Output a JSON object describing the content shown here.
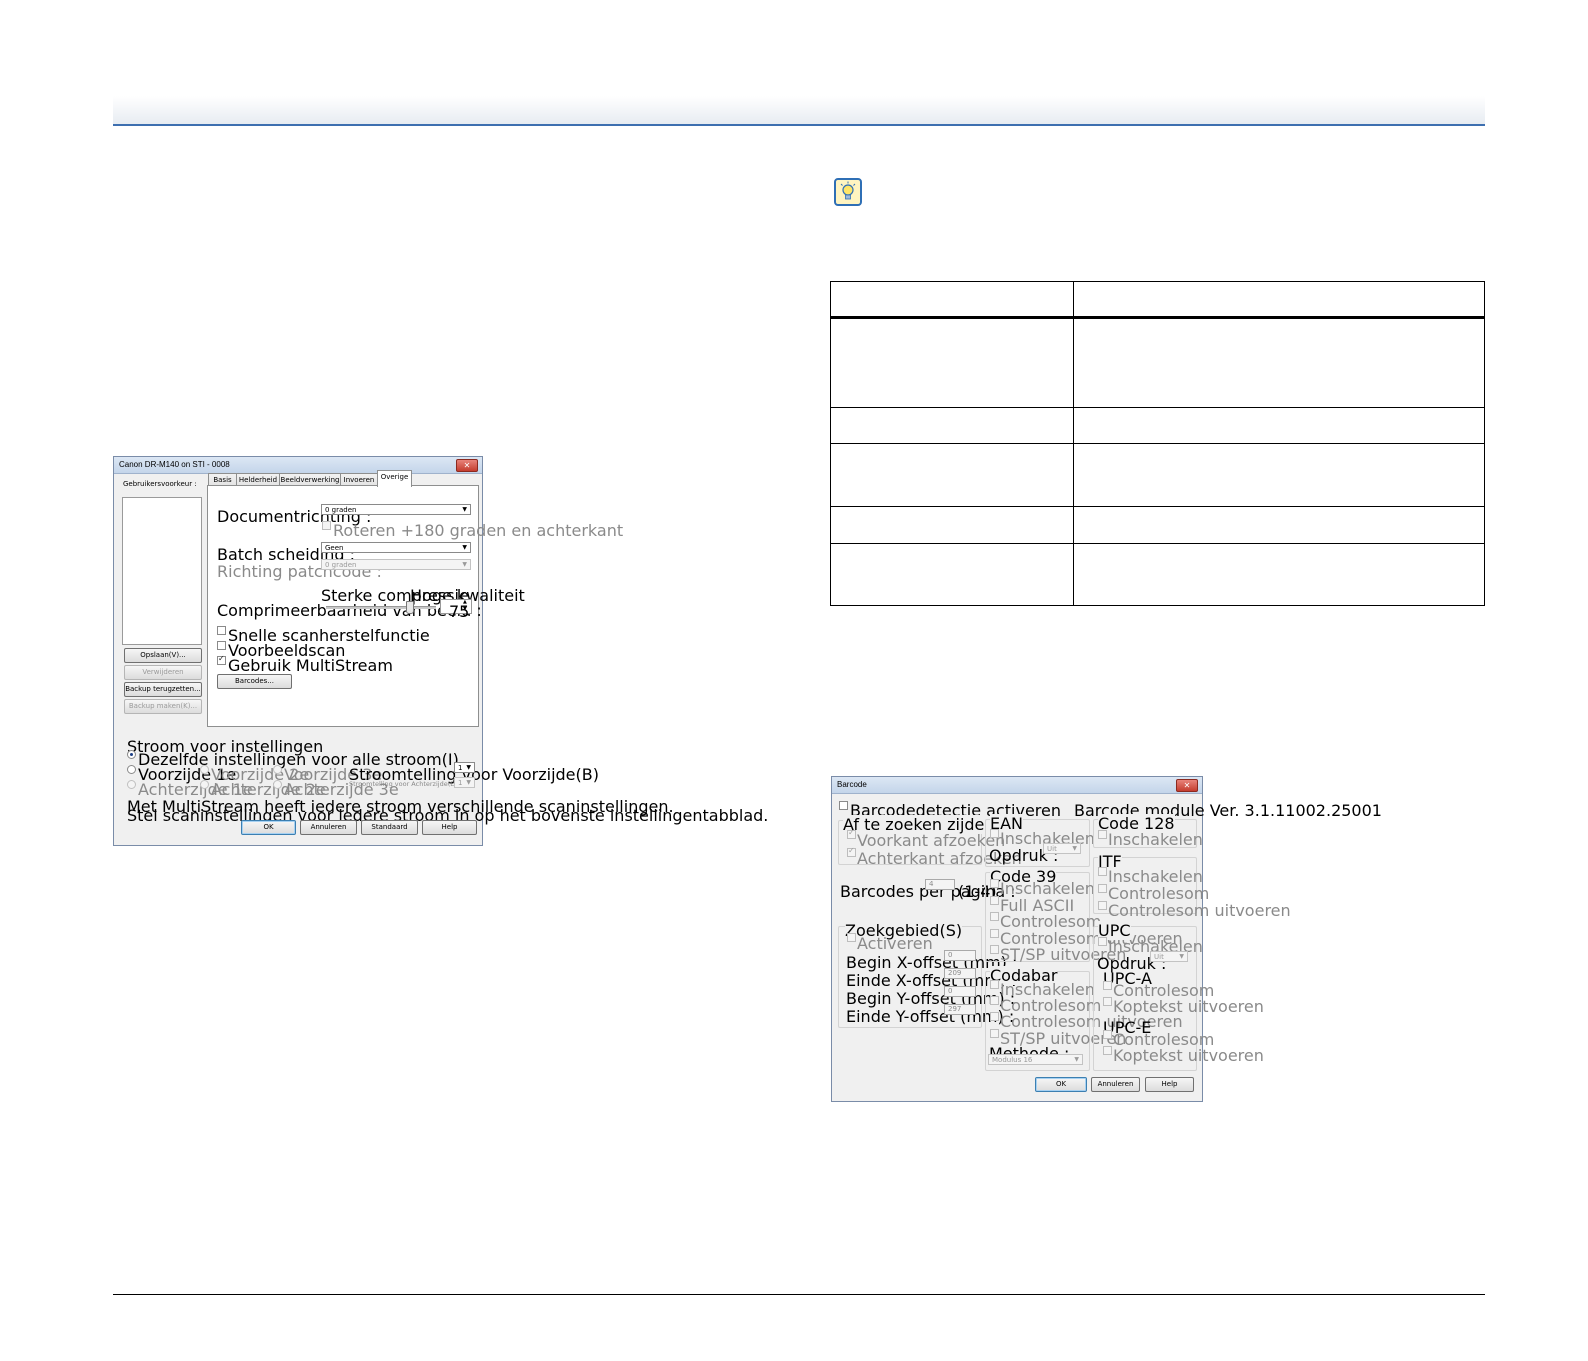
{
  "dialog1": {
    "title": "Canon DR-M140 on STI - 0008",
    "user_prefs_label": "Gebruikersvoorkeur :",
    "tabs": [
      "Basis",
      "Helderheid",
      "Beeldverwerking",
      "Invoeren",
      "Overige"
    ],
    "doc_orientation_label": "Documentrichting :",
    "doc_orientation_value": "0 graden",
    "rotate_label": "Roteren +180 graden en achterkant",
    "batch_label": "Batch scheiding :",
    "batch_value": "Geen",
    "patchcode_label": "Richting patchcode :",
    "patchcode_value": "0 graden",
    "compression_high": "Sterke compressie",
    "compression_quality": "Hoge kwaliteit",
    "compression_label": "Comprimeerbaarheid van beeld :",
    "compression_value": "75",
    "compression_fraction": 0.75,
    "fast_recovery": "Snelle scanherstelfunctie",
    "preview_scan": "Voorbeeldscan",
    "multistream": "Gebruik MultiStream",
    "barcodes_button": "Barcodes...",
    "save_button": "Opslaan(V)...",
    "delete_button": "Verwijderen",
    "restore_button": "Backup terugzetten...",
    "backup_button": "Backup maken(K)...",
    "stream_group": "Stroom voor instellingen",
    "same_settings": "Dezelfde instellingen voor alle stroom(I)",
    "front": [
      "Voorzijde 1e",
      "Voorzijde 2e",
      "Voorzijde 3e"
    ],
    "back": [
      "Achterzijde 1e",
      "Achterzijde 2e",
      "Achterzijde 3e"
    ],
    "stream_count_front_label": "Stroomtelling voor Voorzijde(B)",
    "stream_count_front_value": "1",
    "stream_count_back_label": "Stroomtelling voor Achterzijde(E)",
    "stream_count_back_value": "1",
    "info_line1": "Met MultiStream heeft iedere stroom verschillende scaninstellingen.",
    "info_line2": "Stel scaninstellingen voor iedere stroom in op het bovenste instellingentabblad.",
    "ok": "OK",
    "cancel": "Annuleren",
    "standard": "Standaard",
    "help": "Help"
  },
  "dialog2": {
    "title": "Barcode",
    "enable_label": "Barcodedetectie activeren",
    "version": "Barcode module Ver. 3.1.11002.25001",
    "side_group": "Af te zoeken zijde",
    "front_search": "Voorkant afzoeken",
    "back_search": "Achterkant afzoeken",
    "per_page_label": "Barcodes per pagina :",
    "per_page_value": "4",
    "per_page_range": "(1-4)",
    "search_area": "Zoekgebied(S)",
    "activate": "Activeren",
    "begin_x": "Begin X-offset (mm) :",
    "begin_x_value": "0",
    "end_x": "Einde X-offset (mm) :",
    "end_x_value": "209",
    "begin_y": "Begin Y-offset (mm) :",
    "begin_y_value": "0",
    "end_y": "Einde Y-offset (mm) :",
    "end_y_value": "297",
    "ean": "EAN",
    "enable": "Inschakelen",
    "overprint": "Opdruk :",
    "off": "Uit",
    "code39": "Code 39",
    "full_ascii": "Full ASCII",
    "checksum": "Controlesom",
    "run_checksum": "Controlesom uitvoeren",
    "stsp": "ST/SP uitvoeren",
    "codabar": "Codabar",
    "method": "Methode :",
    "method_value": "Modulus 16",
    "code128": "Code 128",
    "itf": "ITF",
    "upc": "UPC",
    "upca": "UPC-A",
    "upce": "UPC-E",
    "header_out": "Koptekst uitvoeren",
    "ok": "OK",
    "cancel": "Annuleren",
    "help": "Help"
  }
}
